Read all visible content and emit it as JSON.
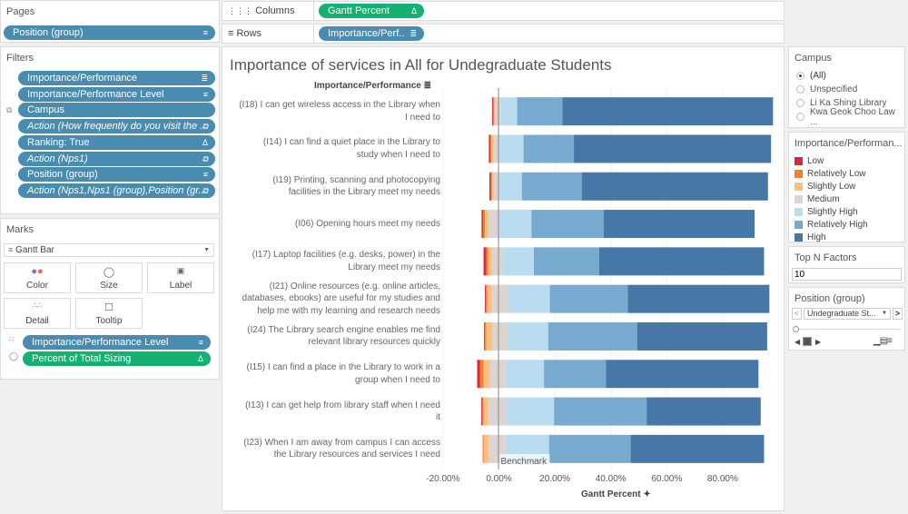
{
  "pages": {
    "title": "Pages",
    "pill": "Position (group)"
  },
  "filters": {
    "title": "Filters",
    "items": [
      {
        "label": "Importance/Performance",
        "icon": "sort-desc-icon",
        "glyph": "≣",
        "italic": false
      },
      {
        "label": "Importance/Performance Level",
        "icon": "sort-asc-icon",
        "glyph": "≡",
        "italic": false
      },
      {
        "label": "Campus",
        "icon": "",
        "glyph": "",
        "italic": false
      },
      {
        "label": "Action (How frequently do you visit the ..",
        "icon": "link-icon",
        "glyph": "⧉",
        "italic": true
      },
      {
        "label": "Ranking: True",
        "icon": "delta-icon",
        "glyph": "Δ",
        "italic": false
      },
      {
        "label": "Action (Nps1)",
        "icon": "link-icon",
        "glyph": "⧉",
        "italic": true
      },
      {
        "label": "Position (group)",
        "icon": "sort-asc-icon",
        "glyph": "≡",
        "italic": false
      },
      {
        "label": "Action (Nps1,Nps1 (group),Position (gr..",
        "icon": "link-icon",
        "glyph": "⧉",
        "italic": true
      }
    ]
  },
  "marks": {
    "title": "Marks",
    "type": "Gantt Bar",
    "buttons": [
      "Color",
      "Size",
      "Label",
      "Detail",
      "Tooltip"
    ],
    "pills": [
      {
        "label": "Importance/Performance Level",
        "color": "blue",
        "glyph": "≡"
      },
      {
        "label": "Percent of Total Sizing",
        "color": "green",
        "glyph": "Δ"
      }
    ]
  },
  "shelves": {
    "columns_label": "Columns",
    "columns_pill": "Gantt Percent",
    "rows_label": "Rows",
    "rows_pill": "Importance/Perf.."
  },
  "campus": {
    "title": "Campus",
    "options": [
      {
        "label": "(All)",
        "selected": true
      },
      {
        "label": "Unspecified",
        "selected": false
      },
      {
        "label": "Li Ka Shing Library",
        "selected": false
      },
      {
        "label": "Kwa Geok Choo Law ...",
        "selected": false
      }
    ]
  },
  "legend": {
    "title": "Importance/Performan...",
    "items": [
      {
        "label": "Low",
        "color": "#d6283e"
      },
      {
        "label": "Relatively Low",
        "color": "#f28229"
      },
      {
        "label": "Slightly Low",
        "color": "#fdbf80"
      },
      {
        "label": "Medium",
        "color": "#dcd4d1"
      },
      {
        "label": "Slightly High",
        "color": "#badcf0"
      },
      {
        "label": "Relatively High",
        "color": "#78aacf"
      },
      {
        "label": "High",
        "color": "#4677a6"
      }
    ]
  },
  "top_n": {
    "title": "Top N Factors",
    "value": "10"
  },
  "position": {
    "title": "Position (group)",
    "value": "Undegraduate St..."
  },
  "chart_data": {
    "type": "bar",
    "stacked": "diverging-gantt",
    "title": "Importance of services in All for Undegraduate Students",
    "row_header": "Importance/Performance",
    "xlabel": "Gantt Percent",
    "xlim": [
      -20,
      100
    ],
    "xticks": [
      "-20.00%",
      "0.00%",
      "20.00%",
      "40.00%",
      "60.00%",
      "80.00%"
    ],
    "xtick_values": [
      -20,
      0,
      20,
      40,
      60,
      80
    ],
    "reference_line": {
      "label": "Benchmark",
      "value": 0
    },
    "segments": [
      "Low",
      "Relatively Low",
      "Slightly Low",
      "Medium",
      "Slightly High",
      "Relatively High",
      "High"
    ],
    "categories": [
      "(I18) I can get wireless access in the Library when I need to",
      "(I14) I can find a quiet place in the Library to study when I need to",
      "(I19) Printing, scanning and photocopying facilities in the Library meet my needs",
      "(I06) Opening hours meet my needs",
      "(I17) Laptop facilities (e.g. desks, power) in the Library meet my needs",
      "(I21) Online resources (e.g. online articles, databases, ebooks) are useful for my studies and help me with my learning and research needs",
      "(I24) The Library search engine enables me find relevant library resources quickly",
      "(I15) I can find a place in the Library to work in a group when I need to",
      "(I13) I can get help from library staff when I need it",
      "(I23) When I am away from campus I can access the Library resources and services I need"
    ],
    "rows": [
      {
        "start": -2.4,
        "values": [
          0.3,
          0.4,
          0.5,
          1.8,
          5.9,
          16.2,
          75.3
        ]
      },
      {
        "start": -3.6,
        "values": [
          0.5,
          0.4,
          0.8,
          1.9,
          8.8,
          18.0,
          70.5
        ]
      },
      {
        "start": -3.4,
        "values": [
          0.5,
          0.4,
          0.6,
          2.1,
          8.0,
          21.4,
          66.6
        ]
      },
      {
        "start": -6.2,
        "values": [
          0.5,
          0.7,
          1.3,
          3.7,
          11.6,
          25.8,
          54.0
        ]
      },
      {
        "start": -5.5,
        "values": [
          1.0,
          0.6,
          1.3,
          4.1,
          11.0,
          23.3,
          59.0
        ]
      },
      {
        "start": -5.0,
        "values": [
          0.3,
          0.5,
          1.7,
          6.1,
          14.6,
          27.9,
          50.6
        ]
      },
      {
        "start": -5.3,
        "values": [
          0.3,
          0.5,
          2.2,
          5.6,
          14.3,
          31.8,
          46.5
        ]
      },
      {
        "start": -7.8,
        "values": [
          1.0,
          1.3,
          2.3,
          5.8,
          13.5,
          22.2,
          54.5
        ]
      },
      {
        "start": -6.3,
        "values": [
          0.4,
          0.4,
          1.7,
          6.6,
          16.9,
          33.1,
          40.8
        ]
      },
      {
        "start": -5.8,
        "values": [
          0.0,
          0.4,
          1.8,
          6.2,
          15.3,
          29.2,
          47.7
        ]
      }
    ],
    "row_label_lines": [
      [
        "(I18) I can get wireless access in the Library when",
        "I need to"
      ],
      [
        "(I14) I can find a quiet place in the Library to",
        "study when I need to"
      ],
      [
        "(I19) Printing, scanning and photocopying",
        "facilities in the Library meet my needs"
      ],
      [
        "(I06) Opening hours meet my needs"
      ],
      [
        "(I17) Laptop facilities (e.g. desks, power) in the",
        "Library meet my needs"
      ],
      [
        "(I21) Online resources (e.g. online articles,",
        "databases, ebooks) are useful for my studies and",
        "help me with my learning and research needs"
      ],
      [
        "(I24) The Library search engine enables me find",
        "relevant library resources quickly"
      ],
      [
        "(I15) I can find a place in the Library to work in a",
        "group when I need to"
      ],
      [
        "(I13) I can get help from library staff when I need",
        "it"
      ],
      [
        "(I23) When I am away from campus I can access",
        "the Library resources and services I need"
      ]
    ]
  }
}
